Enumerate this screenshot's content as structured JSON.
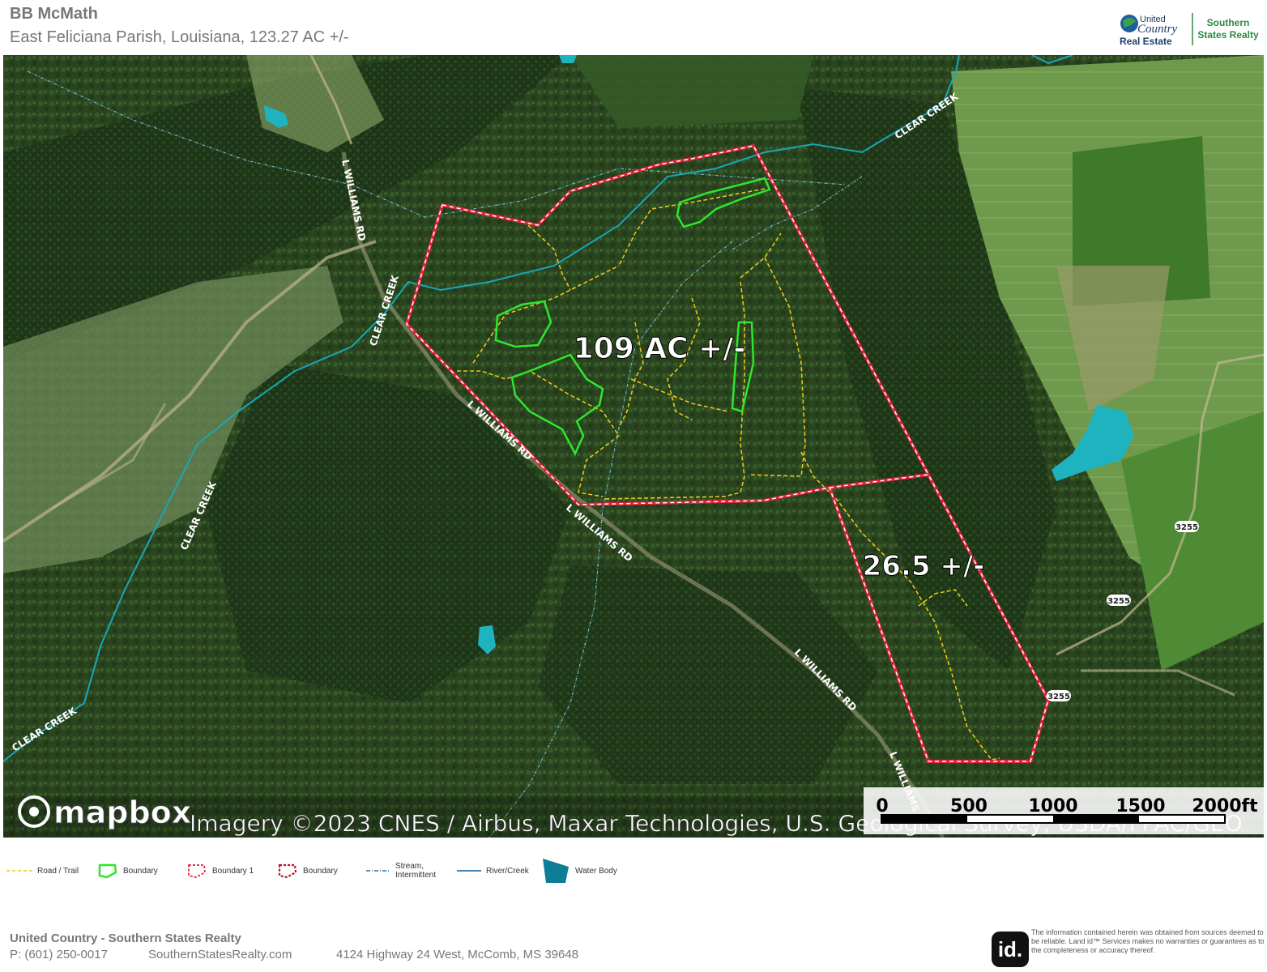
{
  "header": {
    "title": "BB McMath",
    "subtitle": "East Feliciana Parish, Louisiana, 123.27 AC +/-",
    "logo_line1": "United",
    "logo_line2": "Country",
    "logo_line3": "Real Estate",
    "logo_right_line1": "Southern",
    "logo_right_line2": "States Realty"
  },
  "map": {
    "acreage_labels": {
      "main": "109 AC +/-",
      "secondary": "26.5 +/-"
    },
    "road_labels": {
      "l_williams_rd": "L WILLIAMS RD",
      "l_williams_partial": "L WILLIAMS"
    },
    "creek_labels": {
      "clear_creek": "CLEAR CREEK"
    },
    "highway_shields": {
      "hwy": "3255"
    },
    "attribution": {
      "mapbox": "mapbox",
      "imagery": "Imagery ©2023 CNES / Airbus, Maxar Technologies, U.S. Geological Survey, USDA/FPAC/GEO"
    },
    "scale_bar": {
      "ticks": [
        "0",
        "500",
        "1000",
        "1500",
        "2000ft"
      ]
    },
    "colors": {
      "boundary_red": "#e0223a",
      "boundary_green": "#2fe62f",
      "trail_yellow": "#e8c81a",
      "river": "#1aa7b8",
      "water_body": "#1fb3bf"
    }
  },
  "legend": {
    "items": [
      {
        "label": "Road / Trail",
        "icon": "dashed-line-icon"
      },
      {
        "label": "Boundary",
        "icon": "green-polygon-icon"
      },
      {
        "label": "Boundary 1",
        "icon": "red-dashed-polygon-icon"
      },
      {
        "label": "Boundary",
        "icon": "red-dashed-polygon-icon"
      },
      {
        "label": "Stream,",
        "label2": "Intermittent",
        "icon": "dash-dot-line-icon"
      },
      {
        "label": "River/Creek",
        "icon": "solid-line-icon"
      },
      {
        "label": "Water Body",
        "icon": "water-polygon-icon"
      }
    ]
  },
  "footer": {
    "company": "United Country - Southern States Realty",
    "phone": "P: (601) 250-0017",
    "website": "SouthernStatesRealty.com",
    "address": "4124 Highway 24 West, McComb, MS 39648",
    "disclaimer": "The information contained herein was obtained from sources deemed to be reliable. Land id™ Services makes no warranties or guarantees as to the completeness or accuracy thereof.",
    "id_logo": "id."
  }
}
